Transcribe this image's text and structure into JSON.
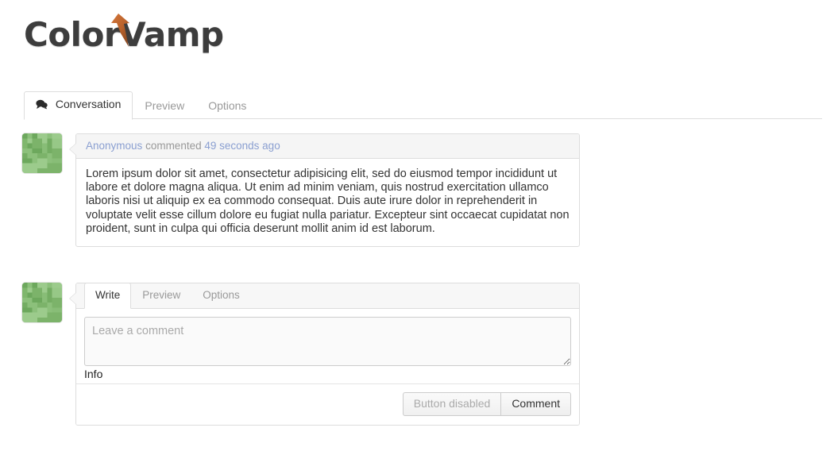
{
  "brand": {
    "name_left": "Color",
    "name_right": "Vamp",
    "accent_color": "#c2622c",
    "text_color": "#3d3d3d",
    "arrow_icon": "arrow-up-icon"
  },
  "top_tabs": [
    {
      "label": "Conversation",
      "icon": "comment-bubble-icon",
      "active": true
    },
    {
      "label": "Preview",
      "active": false
    },
    {
      "label": "Options",
      "active": false
    }
  ],
  "comment": {
    "avatar": "identicon-avatar",
    "author": "Anonymous",
    "action": "commented",
    "timestamp": "49 seconds ago",
    "body": "Lorem ipsum dolor sit amet, consectetur adipisicing elit, sed do eiusmod tempor incididunt ut labore et dolore magna aliqua. Ut enim ad minim veniam, quis nostrud exercitation ullamco laboris nisi ut aliquip ex ea commodo consequat. Duis aute irure dolor in reprehenderit in voluptate velit esse cillum dolore eu fugiat nulla pariatur. Excepteur sint occaecat cupidatat non proident, sunt in culpa qui officia deserunt mollit anim id est laborum."
  },
  "comment_form": {
    "avatar": "identicon-avatar",
    "tabs": [
      {
        "label": "Write",
        "active": true
      },
      {
        "label": "Preview",
        "active": false
      },
      {
        "label": "Options",
        "active": false
      }
    ],
    "textarea": {
      "placeholder": "Leave a comment",
      "value": ""
    },
    "info_label": "Info",
    "buttons": [
      {
        "label": "Button disabled",
        "disabled": true
      },
      {
        "label": "Comment",
        "disabled": false
      }
    ]
  }
}
